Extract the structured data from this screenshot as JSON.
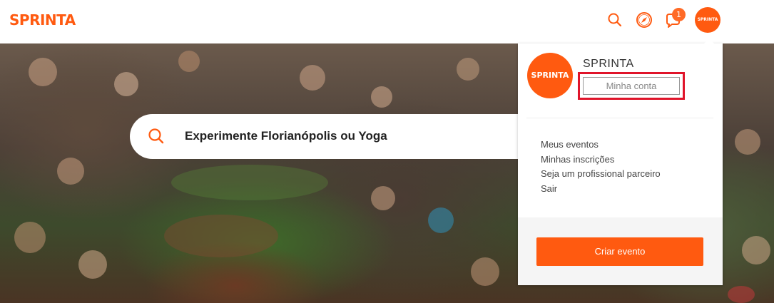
{
  "header": {
    "logo": "SPRINTA",
    "notification_count": "1",
    "avatar_label": "SPRINTA",
    "icons": [
      "search-icon",
      "compass-icon",
      "notification-icon"
    ],
    "accent_color": "#ff5a10"
  },
  "hero": {
    "search_placeholder": "Experimente Florianópolis ou Yoga"
  },
  "account_menu": {
    "avatar_label": "SPRINTA",
    "user_name": "SPRINTA",
    "account_button": "Minha conta",
    "items": [
      {
        "label": "Meus eventos"
      },
      {
        "label": "Minhas inscrições"
      },
      {
        "label": "Seja um profissional parceiro"
      },
      {
        "label": "Sair"
      }
    ],
    "create_event_button": "Criar evento"
  }
}
